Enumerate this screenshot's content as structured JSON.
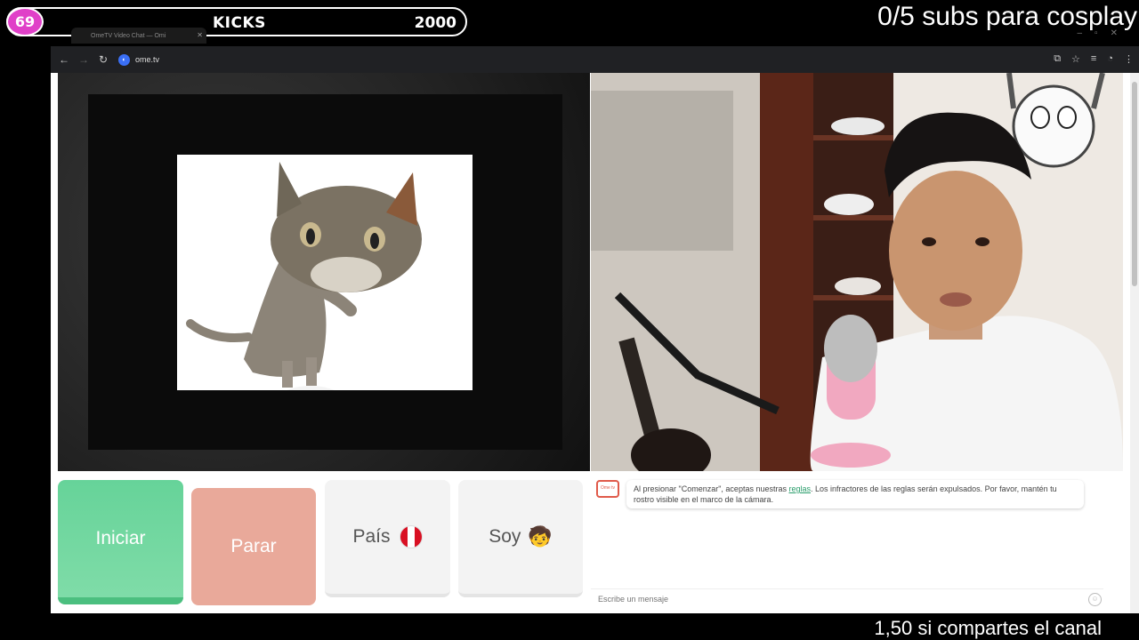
{
  "overlay": {
    "badge": "69",
    "kicks_label": "KICKS",
    "kicks_count": "2000",
    "goal_text": "0/5 subs para cosplay",
    "bottom_text": "1,50 si compartes el canal"
  },
  "browser": {
    "tab_title": "OmeTV Video Chat — Omi",
    "url": "ome.tv"
  },
  "buttons": {
    "start": "Iniciar",
    "stop": "Parar",
    "country": "País",
    "i_am": "Soy",
    "i_am_emoji": "🧒"
  },
  "chat": {
    "logo_text": "Ome tv",
    "message_before": "Al presionar \"Comenzar\", aceptas nuestras ",
    "message_link": "reglas",
    "message_after": ". Los infractores de las reglas serán expulsados. Por favor, mantén tu rostro visible en el marco de la cámara.",
    "input_placeholder": "Escribe un mensaje"
  },
  "colors": {
    "start": "#66d399",
    "stop": "#e9a99a",
    "badge": "#e040c8",
    "link": "#2a9d6b"
  }
}
